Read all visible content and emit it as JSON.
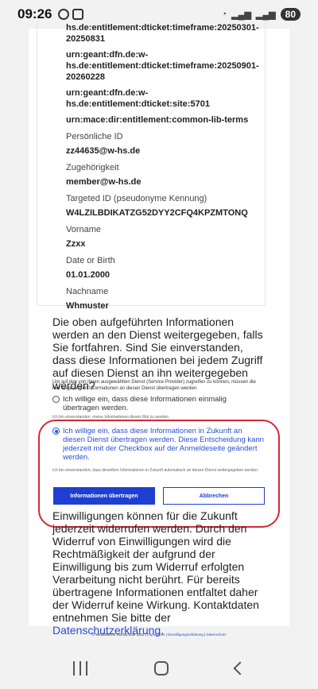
{
  "status_bar": {
    "time": "09:26",
    "battery": "80"
  },
  "attributes": {
    "lines": [
      {
        "kind": "value",
        "text": "hs.de:entitlement:dticket:timeframe:20250301-"
      },
      {
        "kind": "value",
        "text": "20250831"
      },
      {
        "kind": "gap"
      },
      {
        "kind": "value",
        "text": "urn:geant:dfn.de:w-"
      },
      {
        "kind": "value",
        "text": "hs.de:entitlement:dticket:timeframe:20250901-"
      },
      {
        "kind": "value",
        "text": "20260228"
      },
      {
        "kind": "gap"
      },
      {
        "kind": "value",
        "text": "urn:geant:dfn.de:w-"
      },
      {
        "kind": "value",
        "text": "hs.de:entitlement:dticket:site:5701"
      },
      {
        "kind": "gap"
      },
      {
        "kind": "value",
        "text": "urn:mace:dir:entitlement:common-lib-terms"
      },
      {
        "kind": "label",
        "text": "Persönliche ID"
      },
      {
        "kind": "value",
        "text": "zz44635@w-hs.de"
      },
      {
        "kind": "label",
        "text": "Zugehörigkeit"
      },
      {
        "kind": "value",
        "text": "member@w-hs.de"
      },
      {
        "kind": "label",
        "text": "Targeted ID (pseudonyme Kennung)"
      },
      {
        "kind": "value",
        "text": "W4LZILBDIKATZG52DYY2CFQ4KPZMTONQ"
      },
      {
        "kind": "label",
        "text": "Vorname"
      },
      {
        "kind": "value",
        "text": "Zzxx"
      },
      {
        "kind": "label",
        "text": "Date or Birth"
      },
      {
        "kind": "value",
        "text": "01.01.2000"
      },
      {
        "kind": "label",
        "text": "Nachname"
      },
      {
        "kind": "value",
        "text": "Whmuster"
      }
    ]
  },
  "consent": {
    "question": "Die oben aufgeführten Informationen werden an den Dienst weitergegeben, falls Sie fortfahren. Sind Sie einverstanden, dass diese Informationen bei jedem Zugriff auf diesen Dienst an ihn weitergegeben werden?",
    "hint": "Um auf den von Ihnen ausgewählten Dienst (Service Provider) zugreifen zu können, müssen die hier angezeigten Informationen an diesen Dienst übertragen werden.",
    "option_once": {
      "label": "Ich willige ein, dass diese Informationen einmalig übertragen werden.",
      "hint": "Ich bin einverstanden, meine Informationen dieses Mal zu senden.",
      "selected": false
    },
    "option_always": {
      "label": "Ich willige ein, dass diese Informationen in Zukunft an diesen Dienst übertragen werden. Diese Entscheidung kann jederzeit mit der Checkbox auf der Anmeldeseite geändert werden.",
      "hint": "Ich bin einverstanden, dass dieselben Informationen in Zukunft automatisch an diesen Dienst weitergegeben werden.",
      "selected": true
    },
    "submit_label": "Informationen übertragen",
    "cancel_label": "Abbrechen",
    "legal_text": "Einwilligungen können für die Zukunft jederzeit widerrufen werden. Durch den Widerruf von Einwilligungen wird die Rechtmäßigkeit der aufgrund der Einwilligung bis zum Widerruf erfolgten Verarbeitung nicht berührt. Für bereits übertragene Informationen entfaltet daher der Widerruf keine Wirkung. Kontaktdaten entnehmen Sie bitte der",
    "legal_link": "Datenschutzerklärung",
    "legal_end": "."
  },
  "footer": {
    "copyright": "© Westfälische Hochschule 2022 |",
    "link_impressum": "Impressum",
    "sep1": " | ",
    "link_einwilligung": "Einwilligungserklärung",
    "sep2": " | ",
    "link_datenschutz": "Datenschutz"
  },
  "colors": {
    "accent": "#1f3fd1",
    "highlight_ring": "#d22a36"
  }
}
